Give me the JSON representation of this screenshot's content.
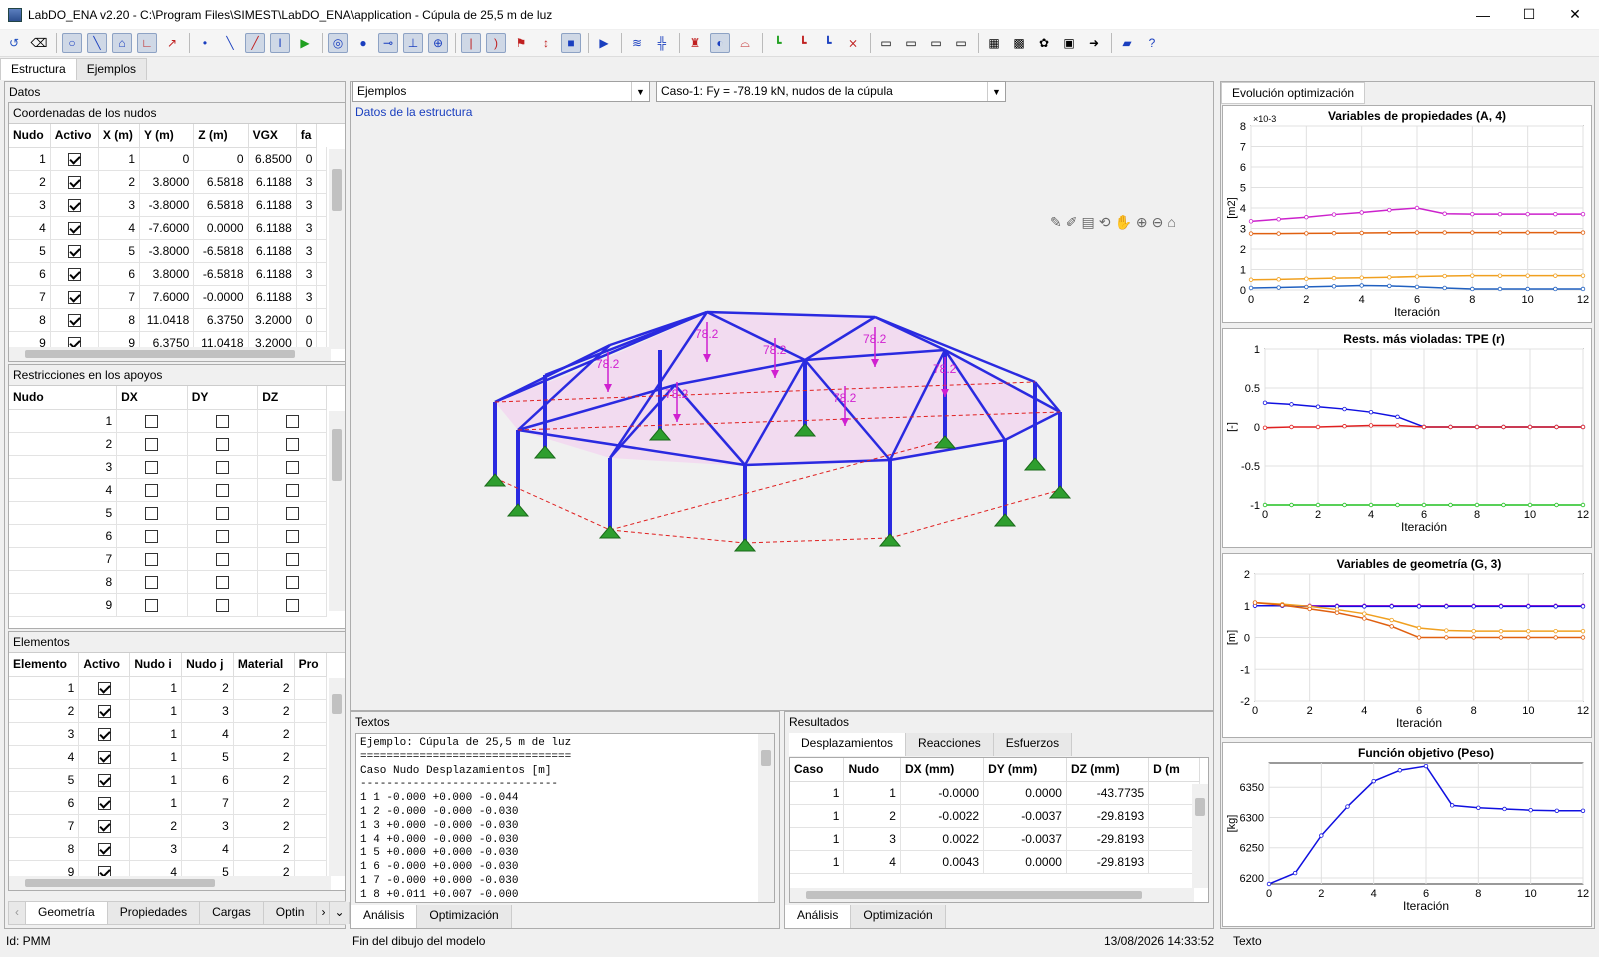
{
  "window": {
    "title": "LabDO_ENA v2.20 - C:\\Program Files\\SIMEST\\LabDO_ENA\\application - Cúpula de 25,5 m de luz"
  },
  "tabs_top": [
    "Estructura",
    "Ejemplos"
  ],
  "left": {
    "datos_label": "Datos",
    "coords_label": "Coordenadas de los nudos",
    "coords_headers": [
      "Nudo",
      "Activo",
      "X (m)",
      "Y (m)",
      "Z (m)",
      "VGX",
      "fa"
    ],
    "coords_rows": [
      [
        "1",
        "0",
        "0",
        "6.8500",
        "0"
      ],
      [
        "2",
        "3.8000",
        "6.5818",
        "6.1188",
        "3"
      ],
      [
        "3",
        "-3.8000",
        "6.5818",
        "6.1188",
        "3"
      ],
      [
        "4",
        "-7.6000",
        "0.0000",
        "6.1188",
        "3"
      ],
      [
        "5",
        "-3.8000",
        "-6.5818",
        "6.1188",
        "3"
      ],
      [
        "6",
        "3.8000",
        "-6.5818",
        "6.1188",
        "3"
      ],
      [
        "7",
        "7.6000",
        "-0.0000",
        "6.1188",
        "3"
      ],
      [
        "8",
        "11.0418",
        "6.3750",
        "3.2000",
        "0"
      ],
      [
        "9",
        "6.3750",
        "11.0418",
        "3.2000",
        "0"
      ]
    ],
    "restr_label": "Restricciones en los apoyos",
    "restr_headers": [
      "Nudo",
      "DX",
      "DY",
      "DZ"
    ],
    "restr_rows": [
      "1",
      "2",
      "3",
      "4",
      "5",
      "6",
      "7",
      "8",
      "9"
    ],
    "elem_label": "Elementos",
    "elem_headers": [
      "Elemento",
      "Activo",
      "Nudo i",
      "Nudo j",
      "Material",
      "Pro"
    ],
    "elem_rows": [
      [
        "1",
        "1",
        "2",
        "2"
      ],
      [
        "2",
        "1",
        "3",
        "2"
      ],
      [
        "3",
        "1",
        "4",
        "2"
      ],
      [
        "4",
        "1",
        "5",
        "2"
      ],
      [
        "5",
        "1",
        "6",
        "2"
      ],
      [
        "6",
        "1",
        "7",
        "2"
      ],
      [
        "7",
        "2",
        "3",
        "2"
      ],
      [
        "8",
        "3",
        "4",
        "2"
      ],
      [
        "9",
        "4",
        "5",
        "2"
      ]
    ],
    "bottom_tabs": [
      "Geometría",
      "Propiedades",
      "Cargas",
      "Optin"
    ]
  },
  "center": {
    "combo1": "Ejemplos",
    "combo2": "Caso-1: Fy = -78.19 kN, nudos de la cúpula",
    "model_label": "Datos de la estructura",
    "load_label": "78.2",
    "textos_label": "Textos",
    "textos_lines": [
      "Ejemplo: Cúpula de 25,5 m de luz",
      "================================",
      "Caso Nudo Desplazamientos [m]",
      "------------------------------",
      "1 1 -0.000 +0.000 -0.044",
      "1 2 -0.000 -0.000 -0.030",
      "1 3 +0.000 -0.000 -0.030",
      "1 4 +0.000 -0.000 -0.030",
      "1 5 +0.000 +0.000 -0.030",
      "1 6 -0.000 +0.000 -0.030",
      "1 7 -0.000 +0.000 -0.030",
      "1 8 +0.011 +0.007 -0.000"
    ],
    "textos_tabs": [
      "Análisis",
      "Optimización"
    ],
    "result_label": "Resultados",
    "result_tabs": [
      "Desplazamientos",
      "Reacciones",
      "Esfuerzos"
    ],
    "result_headers": [
      "Caso",
      "Nudo",
      "DX (mm)",
      "DY (mm)",
      "DZ (mm)",
      "D (m"
    ],
    "result_rows": [
      [
        "1",
        "1",
        "-0.0000",
        "0.0000",
        "-43.7735"
      ],
      [
        "1",
        "2",
        "-0.0022",
        "-0.0037",
        "-29.8193"
      ],
      [
        "1",
        "3",
        "0.0022",
        "-0.0037",
        "-29.8193"
      ],
      [
        "1",
        "4",
        "0.0043",
        "0.0000",
        "-29.8193"
      ]
    ],
    "result_bottom_tabs": [
      "Análisis",
      "Optimización"
    ]
  },
  "right": {
    "tab": "Evolución optimización",
    "xlabel": "Iteración"
  },
  "chart_data": [
    {
      "type": "line",
      "title": "Variables de propiedades (A, 4)",
      "ylabel": "[m2]",
      "xlabel": "Iteración",
      "exponent_label": "×10-3",
      "xlim": [
        0,
        12
      ],
      "ylim": [
        0,
        8
      ],
      "yticks": [
        "0",
        "1",
        "2",
        "3",
        "4",
        "5",
        "6",
        "7",
        "8"
      ],
      "xticks": [
        "0",
        "2",
        "4",
        "6",
        "8",
        "10",
        "12"
      ],
      "x": [
        0,
        1,
        2,
        3,
        4,
        5,
        6,
        7,
        8,
        9,
        10,
        11,
        12
      ],
      "series": [
        {
          "color": "#cc22cc",
          "values": [
            3.35,
            3.45,
            3.55,
            3.68,
            3.78,
            3.9,
            4.0,
            3.72,
            3.7,
            3.7,
            3.7,
            3.7,
            3.7
          ]
        },
        {
          "color": "#e06010",
          "values": [
            2.75,
            2.75,
            2.76,
            2.77,
            2.78,
            2.79,
            2.8,
            2.8,
            2.8,
            2.8,
            2.8,
            2.8,
            2.8
          ]
        },
        {
          "color": "#f0a020",
          "values": [
            0.5,
            0.52,
            0.55,
            0.58,
            0.6,
            0.62,
            0.66,
            0.68,
            0.7,
            0.7,
            0.7,
            0.7,
            0.7
          ]
        },
        {
          "color": "#2060c0",
          "values": [
            0.1,
            0.12,
            0.15,
            0.18,
            0.22,
            0.2,
            0.15,
            0.1,
            0.05,
            0.05,
            0.05,
            0.05,
            0.05
          ]
        }
      ]
    },
    {
      "type": "line",
      "title": "Rests. más violadas: TPE (r)",
      "ylabel": "[-]",
      "xlabel": "Iteración",
      "xlim": [
        0,
        12
      ],
      "ylim": [
        -1,
        1
      ],
      "yticks": [
        "-1",
        "-0.5",
        "0",
        "0.5",
        "1"
      ],
      "xticks": [
        "0",
        "2",
        "4",
        "6",
        "8",
        "10",
        "12"
      ],
      "x": [
        0,
        1,
        2,
        3,
        4,
        5,
        6,
        7,
        8,
        9,
        10,
        11,
        12
      ],
      "series": [
        {
          "color": "#1010e0",
          "values": [
            0.31,
            0.29,
            0.26,
            0.23,
            0.19,
            0.13,
            0.0,
            0.0,
            0.0,
            0.0,
            0.0,
            0.0,
            0.0
          ]
        },
        {
          "color": "#e02020",
          "values": [
            -0.01,
            0.0,
            0.0,
            0.01,
            0.02,
            0.02,
            0.0,
            0.0,
            0.0,
            0.0,
            0.0,
            0.0,
            0.0
          ]
        },
        {
          "color": "#20c020",
          "values": [
            -1,
            -1,
            -1,
            -1,
            -1,
            -1,
            -1,
            -1,
            -1,
            -1,
            -1,
            -1,
            -1
          ]
        }
      ]
    },
    {
      "type": "line",
      "title": "Variables de geometría (G, 3)",
      "ylabel": "[m]",
      "xlabel": "Iteración",
      "xlim": [
        0,
        12
      ],
      "ylim": [
        -2,
        2
      ],
      "yticks": [
        "-2",
        "-1",
        "0",
        "1",
        "2"
      ],
      "xticks": [
        "0",
        "2",
        "4",
        "6",
        "8",
        "10",
        "12"
      ],
      "x": [
        0,
        1,
        2,
        3,
        4,
        5,
        6,
        7,
        8,
        9,
        10,
        11,
        12
      ],
      "series": [
        {
          "color": "#cc22cc",
          "values": [
            1.0,
            1.0,
            1.0,
            1.0,
            1.0,
            1.0,
            1.0,
            1.0,
            1.0,
            1.0,
            1.0,
            1.0,
            1.0
          ]
        },
        {
          "color": "#1010e0",
          "values": [
            1.0,
            1.0,
            0.98,
            0.98,
            0.98,
            0.98,
            0.98,
            0.98,
            0.98,
            0.98,
            0.98,
            0.98,
            0.98
          ]
        },
        {
          "color": "#f0a020",
          "values": [
            1.1,
            1.05,
            0.98,
            0.88,
            0.75,
            0.55,
            0.3,
            0.22,
            0.2,
            0.2,
            0.2,
            0.2,
            0.2
          ]
        },
        {
          "color": "#e06010",
          "values": [
            1.1,
            1.02,
            0.9,
            0.78,
            0.6,
            0.35,
            0.0,
            0.0,
            0.0,
            0.0,
            0.0,
            0.0,
            0.0
          ]
        }
      ]
    },
    {
      "type": "line",
      "title": "Función objetivo (Peso)",
      "ylabel": "[kg]",
      "xlabel": "Iteración",
      "xlim": [
        0,
        12
      ],
      "ylim": [
        6190,
        6390
      ],
      "yticks": [
        "6200",
        "6250",
        "6300",
        "6350"
      ],
      "xticks": [
        "0",
        "2",
        "4",
        "6",
        "8",
        "10",
        "12"
      ],
      "x": [
        0,
        1,
        2,
        3,
        4,
        5,
        6,
        7,
        8,
        9,
        10,
        11,
        12
      ],
      "series": [
        {
          "color": "#1010e0",
          "values": [
            6190,
            6208,
            6270,
            6318,
            6360,
            6378,
            6385,
            6320,
            6316,
            6314,
            6312,
            6311,
            6311
          ]
        }
      ]
    }
  ],
  "status": {
    "left": "Id: PMM",
    "center": "Fin del dibujo del modelo",
    "datetime": "13/08/2026 14:33:52",
    "right": "Texto"
  }
}
